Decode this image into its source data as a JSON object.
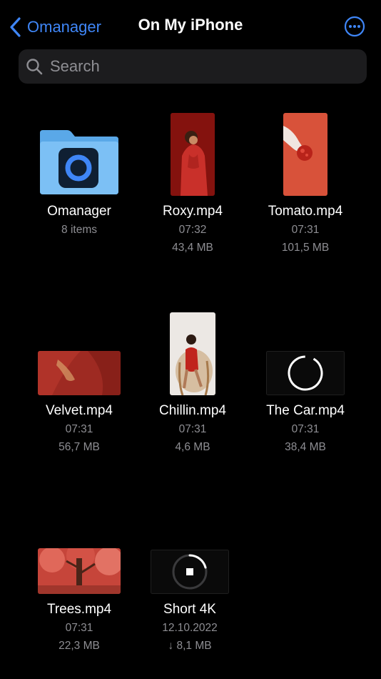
{
  "nav": {
    "back_label": "Omanager",
    "title": "On My iPhone"
  },
  "search": {
    "placeholder": "Search"
  },
  "colors": {
    "accent": "#3f86f7",
    "background": "#000000",
    "secondary_text": "#8e8e93",
    "search_bg": "#1c1c1e"
  },
  "items": [
    {
      "name": "Omanager",
      "line1": "8 items",
      "line2": "",
      "kind": "folder",
      "icon": "folder-icon"
    },
    {
      "name": "Roxy.mp4",
      "line1": "07:32",
      "line2": "43,4 MB",
      "kind": "video-thumbnail"
    },
    {
      "name": "Tomato.mp4",
      "line1": "07:31",
      "line2": "101,5 MB",
      "kind": "video-thumbnail"
    },
    {
      "name": "Velvet.mp4",
      "line1": "07:31",
      "line2": "56,7 MB",
      "kind": "video-thumbnail"
    },
    {
      "name": "Chillin.mp4",
      "line1": "07:31",
      "line2": "4,6 MB",
      "kind": "video-thumbnail"
    },
    {
      "name": "The Car.mp4",
      "line1": "07:31",
      "line2": "38,4 MB",
      "kind": "loading",
      "icon": "loading-spinner-icon"
    },
    {
      "name": "Trees.mp4",
      "line1": "07:31",
      "line2": "22,3 MB",
      "kind": "video-thumbnail"
    },
    {
      "name": "Short 4K",
      "line1": "12.10.2022",
      "line2": "↓ 8,1 MB",
      "kind": "downloading",
      "icon": "stop-download-icon"
    }
  ]
}
